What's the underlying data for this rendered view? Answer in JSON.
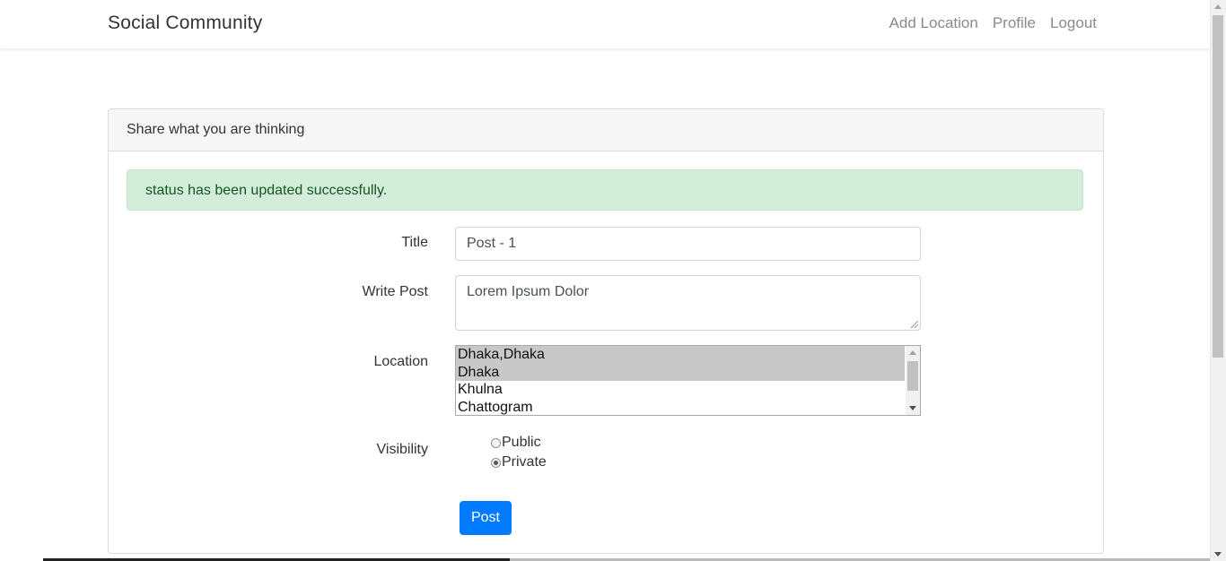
{
  "navbar": {
    "brand": "Social Community",
    "links": [
      "Add Location",
      "Profile",
      "Logout"
    ]
  },
  "card": {
    "header": "Share what you are thinking",
    "alert": "status has been updated successfully."
  },
  "form": {
    "title_label": "Title",
    "title_value": "Post - 1",
    "post_label": "Write Post",
    "post_value": "Lorem Ipsum Dolor",
    "location_label": "Location",
    "location_options": [
      {
        "label": "Dhaka,Dhaka",
        "selected": true
      },
      {
        "label": "Dhaka",
        "selected": true
      },
      {
        "label": "Khulna",
        "selected": false
      },
      {
        "label": "Chattogram",
        "selected": false
      }
    ],
    "visibility_label": "Visibility",
    "visibility_options": [
      {
        "label": "Public",
        "checked": false
      },
      {
        "label": "Private",
        "checked": true
      }
    ],
    "submit_label": "Post"
  },
  "colors": {
    "primary": "#007bff",
    "alert_bg": "#d4edda",
    "alert_text": "#155724",
    "selected_option": "#c8c8c8"
  }
}
